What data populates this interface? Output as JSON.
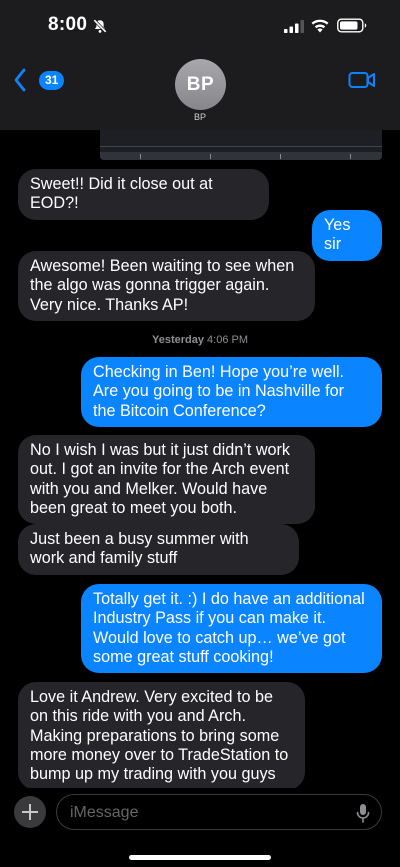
{
  "status_bar": {
    "time": "8:00",
    "icons": [
      "bell-slash-icon",
      "signal-icon",
      "wifi-icon",
      "battery-icon"
    ]
  },
  "header": {
    "back_badge": "31",
    "avatar_initials": "BP",
    "contact_name": "BP"
  },
  "messages": [
    {
      "direction": "incoming",
      "text": "Sweet!! Did it close out at EOD?!"
    },
    {
      "direction": "outgoing",
      "text": "Yes sir"
    },
    {
      "direction": "incoming",
      "text": "Awesome! Been waiting to see when the algo was gonna trigger again. Very nice. Thanks AP!"
    },
    {
      "direction": "outgoing",
      "text": "Checking in Ben! Hope you’re well. Are you going to be in Nashville for the Bitcoin Conference?"
    },
    {
      "direction": "incoming",
      "text": "No I wish I was but it just didn’t work out. I got an invite for the Arch event with you and Melker. Would have been great to meet you both."
    },
    {
      "direction": "incoming",
      "text": "Just been a busy summer with work and family stuff"
    },
    {
      "direction": "outgoing",
      "text": "Totally get it. :) I do have an additional Industry Pass if you can make it. Would love to catch up… we’ve got some great stuff cooking!"
    },
    {
      "direction": "incoming",
      "text": "Love it Andrew. Very excited to be on this ride with you and Arch. Making preparations to bring some more money over to TradeStation to bump up my trading with you guys"
    }
  ],
  "timestamp": {
    "day": "Yesterday",
    "time": "4:06 PM"
  },
  "composer": {
    "placeholder": "iMessage"
  },
  "colors": {
    "incoming_bubble": "#26252a",
    "outgoing_bubble": "#0a84ff",
    "background": "#000000",
    "header": "#1c1c1e"
  }
}
